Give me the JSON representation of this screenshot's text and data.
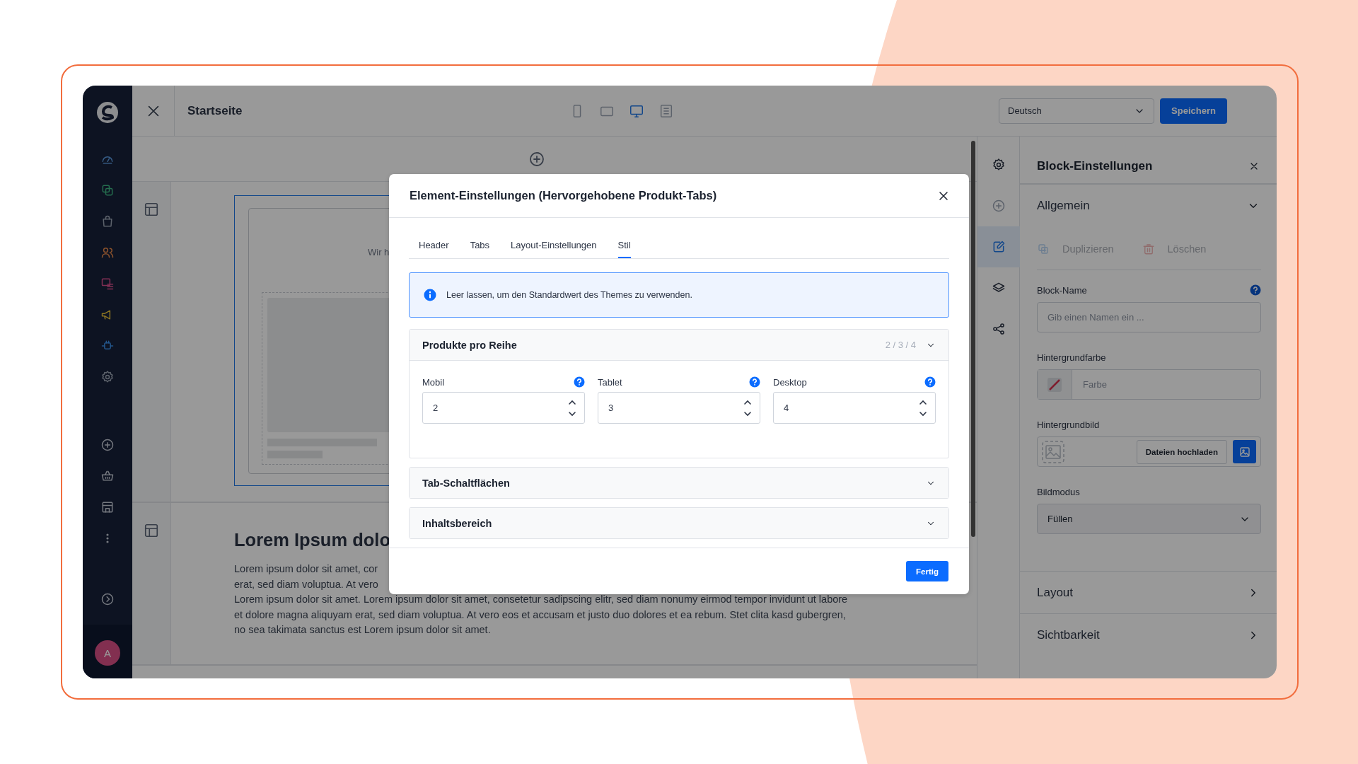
{
  "sidebar": {
    "items": [
      {
        "kind": "dashboard"
      },
      {
        "kind": "catalog"
      },
      {
        "kind": "orders"
      },
      {
        "kind": "customers"
      },
      {
        "kind": "content"
      },
      {
        "kind": "marketing"
      },
      {
        "kind": "extensions"
      },
      {
        "kind": "settings"
      },
      {
        "kind": "add"
      },
      {
        "kind": "basket"
      },
      {
        "kind": "store"
      },
      {
        "kind": "more"
      }
    ],
    "avatar": "A"
  },
  "top_bar": {
    "title": "Startseite",
    "devices": [
      {
        "kind": "mobile",
        "selected": false
      },
      {
        "kind": "tablet",
        "selected": false
      },
      {
        "kind": "desktop",
        "selected": true
      },
      {
        "kind": "list",
        "selected": false
      }
    ],
    "language": "Deutsch",
    "save_button": "Speichern"
  },
  "canvas": {
    "teaser_text": "Wir h",
    "heading": "Lorem Ipsum dolo",
    "paragraph_lines": [
      "Lorem ipsum dolor sit amet, cor",
      "erat, sed diam voluptua. At vero",
      "Lorem ipsum dolor sit amet. Lorem ipsum dolor sit amet, consetetur sadipscing elitr, sed diam nonumy eirmod tempor invidunt ut labore",
      "et dolore magna aliquyam erat, sed diam voluptua. At vero eos et accusam et justo duo dolores et ea rebum. Stet clita kasd gubergren,",
      "no sea takimata sanctus est Lorem ipsum dolor sit amet."
    ]
  },
  "tool_strip": [
    {
      "kind": "settings",
      "selected": false
    },
    {
      "kind": "add",
      "selected": false
    },
    {
      "kind": "edit",
      "selected": true
    },
    {
      "kind": "layers",
      "selected": false
    },
    {
      "kind": "share",
      "selected": false
    }
  ],
  "block_settings": {
    "title": "Block-Einstellungen",
    "general": {
      "title": "Allgemein",
      "expanded": true,
      "actions": [
        {
          "kind": "duplicate",
          "label": "Duplizieren",
          "disabled": true
        },
        {
          "kind": "delete",
          "label": "Löschen",
          "disabled": true
        }
      ],
      "block_name": {
        "label": "Block-Name",
        "placeholder": "Gib einen Namen ein ..."
      },
      "background_color": {
        "label": "Hintergrundfarbe",
        "placeholder": "Farbe"
      },
      "background_image": {
        "label": "Hintergrundbild",
        "upload_button": "Dateien hochladen"
      },
      "image_mode": {
        "label": "Bildmodus",
        "value": "Füllen"
      }
    },
    "sections": [
      {
        "title": "Layout",
        "expanded": false
      },
      {
        "title": "Sichtbarkeit",
        "expanded": false
      }
    ]
  },
  "modal": {
    "title": "Element-Einstellungen (Hervorgehobene Produkt-Tabs)",
    "tabs": [
      {
        "label": "Header",
        "selected": false
      },
      {
        "label": "Tabs",
        "selected": false
      },
      {
        "label": "Layout-Einstellungen",
        "selected": false
      },
      {
        "label": "Stil",
        "selected": true
      }
    ],
    "info": "Leer lassen, um den Standardwert des Themes zu verwenden.",
    "accordions": [
      {
        "title": "Produkte pro Reihe",
        "summary": "2 / 3 / 4",
        "expanded": true,
        "fields": [
          {
            "label": "Mobil",
            "value": "2"
          },
          {
            "label": "Tablet",
            "value": "3"
          },
          {
            "label": "Desktop",
            "value": "4"
          }
        ]
      },
      {
        "title": "Tab-Schaltflächen",
        "expanded": false
      },
      {
        "title": "Inhaltsbereich",
        "expanded": false
      }
    ],
    "done_button": "Fertig"
  }
}
